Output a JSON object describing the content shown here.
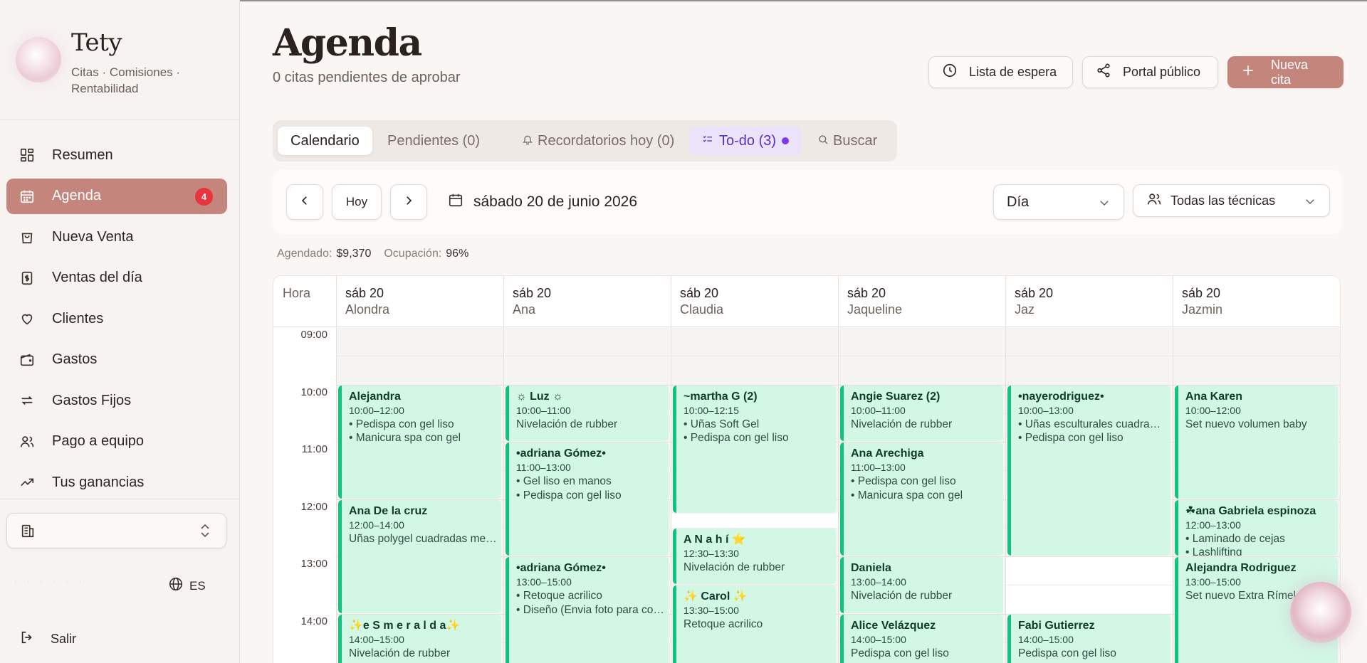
{
  "brand": {
    "name": "Tety",
    "subtitle": "Citas · Comisiones · Rentabilidad"
  },
  "nav": [
    {
      "label": "Resumen",
      "icon": "dashboard-icon"
    },
    {
      "label": "Agenda",
      "icon": "calendar-icon",
      "active": true,
      "badge": "4"
    },
    {
      "label": "Nueva Venta",
      "icon": "shopping-bag-icon"
    },
    {
      "label": "Ventas del día",
      "icon": "receipt-dollar-icon"
    },
    {
      "label": "Clientes",
      "icon": "heart-icon"
    },
    {
      "label": "Gastos",
      "icon": "wallet-icon"
    },
    {
      "label": "Gastos Fijos",
      "icon": "repeat-icon"
    },
    {
      "label": "Pago a equipo",
      "icon": "users-icon"
    },
    {
      "label": "Tus ganancias",
      "icon": "trending-up-icon"
    }
  ],
  "language": "ES",
  "logout_label": "Salir",
  "header": {
    "title": "Agenda",
    "subtitle": "0 citas pendientes de aprobar",
    "waitlist_label": "Lista de espera",
    "portal_label": "Portal público",
    "new_label": "Nueva cita"
  },
  "tabs": {
    "calendar": "Calendario",
    "pending": "Pendientes (0)",
    "reminders": "Recordatorios hoy (0)",
    "todo": "To-do (3)",
    "search": "Buscar"
  },
  "toolbar": {
    "today_label": "Hoy",
    "date_label": "sábado 20 de junio 2026",
    "view_value": "Día",
    "staff_value": "Todas las técnicas"
  },
  "stats": {
    "scheduled_label": "Agendado:",
    "scheduled_value": "$9,370",
    "occupancy_label": "Ocupación:",
    "occupancy_value": "96%"
  },
  "calendar": {
    "hour_header": "Hora",
    "hours": [
      "09:00",
      "10:00",
      "11:00",
      "12:00",
      "13:00",
      "14:00"
    ],
    "columns": [
      {
        "day": "sáb 20",
        "name": "Alondra"
      },
      {
        "day": "sáb 20",
        "name": "Ana"
      },
      {
        "day": "sáb 20",
        "name": "Claudia"
      },
      {
        "day": "sáb 20",
        "name": "Jaqueline"
      },
      {
        "day": "sáb 20",
        "name": "Jaz"
      },
      {
        "day": "sáb 20",
        "name": "Jazmin"
      }
    ],
    "appointments": [
      {
        "col": 0,
        "start": 10.0,
        "end": 12.0,
        "title": "Alejandra",
        "time": "10:00–12:00",
        "services": [
          "• Pedispa con gel liso",
          "• Manicura spa con gel"
        ]
      },
      {
        "col": 0,
        "start": 12.0,
        "end": 14.0,
        "title": "Ana De la cruz",
        "time": "12:00–14:00",
        "services": [
          "Uñas polygel cuadradas media..."
        ]
      },
      {
        "col": 0,
        "start": 14.0,
        "end": 15.0,
        "title": "✨e S m e r a l d a✨",
        "time": "14:00–15:00",
        "services": [
          "Nivelación de rubber"
        ]
      },
      {
        "col": 1,
        "start": 10.0,
        "end": 11.0,
        "title": "☼ Luz ☼",
        "time": "10:00–11:00",
        "services": [
          "Nivelación de rubber"
        ]
      },
      {
        "col": 1,
        "start": 11.0,
        "end": 13.0,
        "title": "•adriana Gómez•",
        "time": "11:00–13:00",
        "services": [
          "• Gel liso en manos",
          "• Pedispa con gel liso"
        ]
      },
      {
        "col": 1,
        "start": 13.0,
        "end": 15.0,
        "title": "•adriana Gómez•",
        "time": "13:00–15:00",
        "services": [
          "• Retoque acrilico",
          "• Diseño (Envia foto para cotizar)"
        ]
      },
      {
        "col": 2,
        "start": 10.0,
        "end": 12.25,
        "title": "~martha G (2)",
        "time": "10:00–12:15",
        "services": [
          "• Uñas Soft Gel",
          "• Pedispa con gel liso"
        ]
      },
      {
        "col": 2,
        "start": 12.5,
        "end": 13.5,
        "title": "A N a h í ⭐",
        "time": "12:30–13:30",
        "services": [
          "Nivelación de rubber"
        ]
      },
      {
        "col": 2,
        "start": 13.5,
        "end": 15.0,
        "title": "✨ Carol ✨",
        "time": "13:30–15:00",
        "services": [
          "Retoque acrilico"
        ]
      },
      {
        "col": 3,
        "start": 10.0,
        "end": 11.0,
        "title": "Angie Suarez (2)",
        "time": "10:00–11:00",
        "services": [
          "Nivelación de rubber"
        ]
      },
      {
        "col": 3,
        "start": 11.0,
        "end": 13.0,
        "title": "Ana Arechiga",
        "time": "11:00–13:00",
        "services": [
          "• Pedispa con gel liso",
          "• Manicura spa con gel"
        ]
      },
      {
        "col": 3,
        "start": 13.0,
        "end": 14.0,
        "title": "Daniela",
        "time": "13:00–14:00",
        "services": [
          "Nivelación de rubber"
        ]
      },
      {
        "col": 3,
        "start": 14.0,
        "end": 15.0,
        "title": "Alice Velázquez",
        "time": "14:00–15:00",
        "services": [
          "Pedispa con gel liso"
        ]
      },
      {
        "col": 4,
        "start": 10.0,
        "end": 13.0,
        "title": "•nayerodriguez•",
        "time": "10:00–13:00",
        "services": [
          "• Uñas esculturales cuadradas",
          "• Pedispa con gel liso"
        ]
      },
      {
        "col": 4,
        "start": 14.0,
        "end": 15.0,
        "title": "Fabi Gutierrez",
        "time": "14:00–15:00",
        "services": [
          "Pedispa con gel liso"
        ]
      },
      {
        "col": 5,
        "start": 10.0,
        "end": 12.0,
        "title": "Ana Karen",
        "time": "10:00–12:00",
        "services": [
          "Set nuevo volumen baby"
        ]
      },
      {
        "col": 5,
        "start": 12.0,
        "end": 13.0,
        "title": "☘ana Gabriela espinoza",
        "time": "12:00–13:00",
        "services": [
          "• Laminado de cejas",
          "• Lashlifting"
        ]
      },
      {
        "col": 5,
        "start": 13.0,
        "end": 15.0,
        "title": "Alejandra Rodriguez",
        "time": "13:00–15:00",
        "services": [
          "Set nuevo Extra Rímel"
        ]
      }
    ]
  },
  "colors": {
    "accent": "#c4857c",
    "appointment_bg": "#d2f7e5",
    "appointment_border": "#10c47f",
    "badge": "#e8343c",
    "todo": "#7c3aed"
  }
}
